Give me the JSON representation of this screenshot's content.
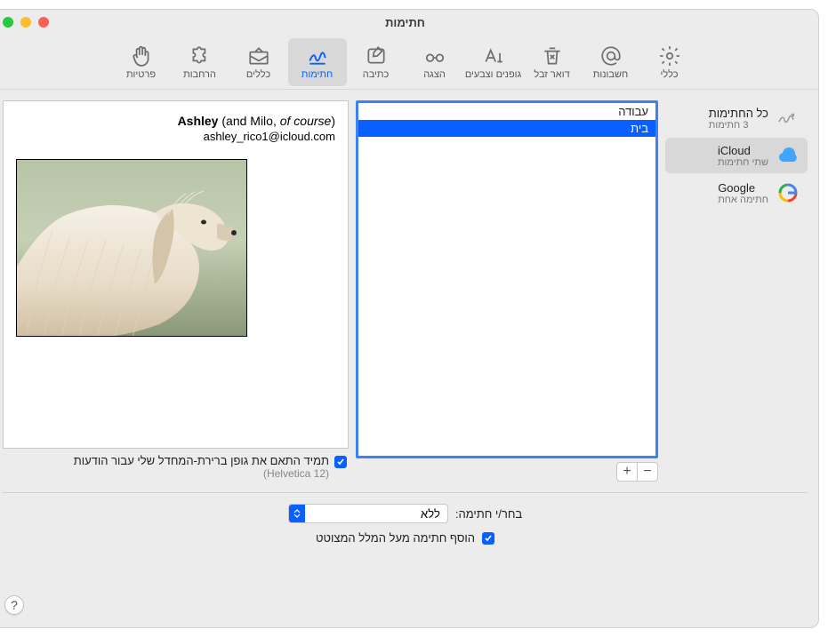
{
  "window": {
    "title": "חתימות"
  },
  "toolbar": {
    "items": [
      {
        "label": "כללי"
      },
      {
        "label": "חשבונות"
      },
      {
        "label": "דואר זבל"
      },
      {
        "label": "גופנים וצבעים"
      },
      {
        "label": "הצגה"
      },
      {
        "label": "כתיבה"
      },
      {
        "label": "חתימות"
      },
      {
        "label": "כללים"
      },
      {
        "label": "הרחבות"
      },
      {
        "label": "פרטיות"
      }
    ]
  },
  "sidebar": {
    "items": [
      {
        "title": "כל החתימות",
        "sub": "3 חתימות"
      },
      {
        "title": "iCloud",
        "sub": "שתי חתימות"
      },
      {
        "title": "Google",
        "sub": "חתימה אחת"
      }
    ]
  },
  "signatures": {
    "items": [
      {
        "name": "עבודה"
      },
      {
        "name": "בית"
      }
    ]
  },
  "preview": {
    "name_bold": "Ashley",
    "name_rest": " (and Milo, ",
    "name_italic": "of course",
    "name_close": ")",
    "email": "ashley_rico1@icloud.com"
  },
  "font_checkbox": {
    "label": "תמיד התאם את גופן ברירת-המחדל שלי עבור הודעות",
    "sub": "(Helvetica 12)"
  },
  "bottom": {
    "choose_label": "בחר/י חתימה:",
    "select_value": "ללא",
    "place_above": "הוסף חתימה מעל המלל המצוטט"
  },
  "help": "?"
}
